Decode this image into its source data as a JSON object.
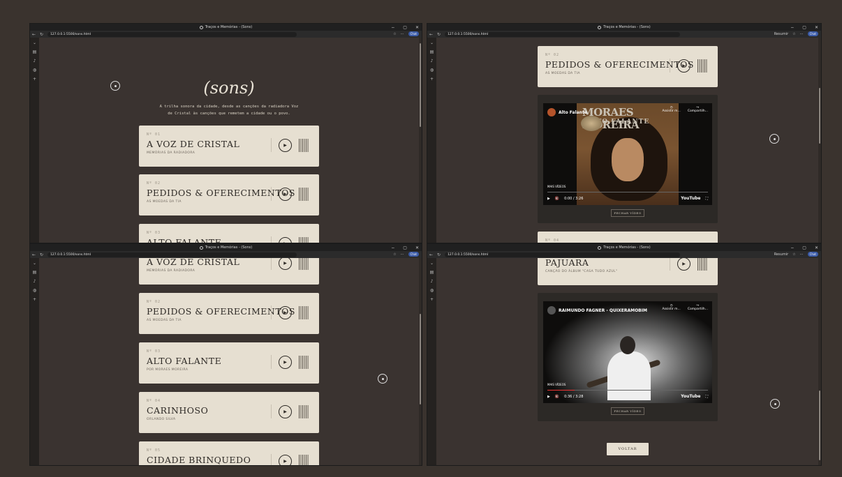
{
  "window": {
    "title": "Traços e Memórias - (Sons)",
    "url": "127.0.0.1:5500/sons.html",
    "chat_label": "Chat",
    "resumir_label": "Resumir",
    "controls": [
      "−",
      "▢",
      "✕"
    ]
  },
  "page": {
    "title": "(sons)",
    "subtitle_line1": "A trilha sonora da cidade, desde as canções da radiadora Voz",
    "subtitle_line2": "de Cristal às canções que remetem a cidade ou o povo."
  },
  "tracks": [
    {
      "num": "Nº 01",
      "title": "A VOZ DE CRISTAL",
      "sub": "MEMÓRIAS DA RADIADORA"
    },
    {
      "num": "Nº 02",
      "title": "PEDIDOS & OFERECIMENTOS",
      "sub": "AS MOEDAS DA TIA"
    },
    {
      "num": "Nº 03",
      "title": "ALTO FALANTE",
      "sub": "POR MORAES MOREIRA"
    },
    {
      "num": "Nº 04",
      "title": "CARINHOSO",
      "sub": "ORLANDO SILVA"
    },
    {
      "num": "Nº 05",
      "title": "CIDADE BRINQUEDO",
      "sub": ""
    },
    {
      "num": "",
      "title": "PAJUARA",
      "sub": "CANÇÃO DO ÁLBUM \"CASA TUDO AZUL\""
    }
  ],
  "video1": {
    "channel": "Alto Falante",
    "art_title": "MORAES MOREIRA",
    "art_sub": "ALTO FALANTE",
    "watch_label": "Assistir m...",
    "share_label": "Compartilh...",
    "more_label": "MAIS VÍDEOS",
    "time": "0:00 / 3:26",
    "progress": 0,
    "close_label": "FECHAR VÍDEO"
  },
  "video2": {
    "channel": "RAIMUNDO FAGNER - QUIXERAMOBIM",
    "watch_label": "Assistir m...",
    "share_label": "Compartilh...",
    "more_label": "MAIS VÍDEOS",
    "time": "0:36 / 3:28",
    "progress": 0.17,
    "close_label": "FECHAR VÍDEO"
  },
  "misc": {
    "next_num": "Nº 04",
    "back_label": "VOLTAR",
    "youtube": "YouTube"
  }
}
